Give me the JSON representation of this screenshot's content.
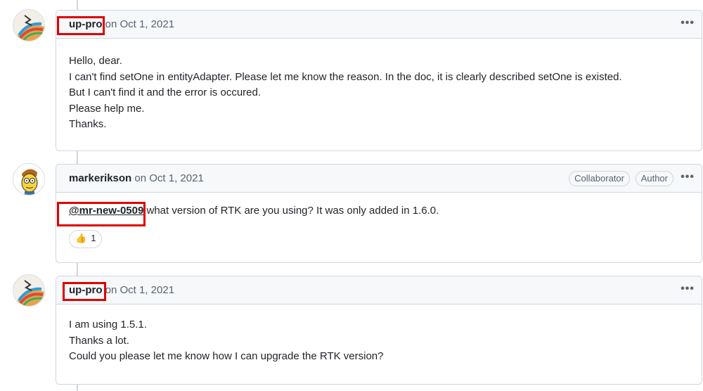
{
  "comments": [
    {
      "author": "up-pro",
      "meta": " on Oct 1, 2021",
      "menu": "•••",
      "lines": [
        "Hello, dear.",
        "I can't find setOne in entityAdapter. Please let me know the reason. In the doc, it is clearly described setOne is existed.",
        "But I can't find it and the error is occured.",
        "Please help me.",
        "Thanks."
      ]
    },
    {
      "author": "markerikson",
      "meta": " on Oct 1, 2021",
      "badges": [
        "Collaborator",
        "Author"
      ],
      "menu": "•••",
      "mention": "@mr-new-0509",
      "text": " what version of RTK are you using? It was only added in 1.6.0.",
      "reaction": {
        "emoji": "👍",
        "count": "1"
      }
    },
    {
      "author": "up-pro",
      "meta": " on Oct 1, 2021",
      "menu": "•••",
      "lines": [
        "I am using 1.5.1.",
        "Thanks a lot.",
        "Could you please let me know how I can upgrade the RTK version?"
      ]
    }
  ],
  "colors": {
    "highlight": "#e00000",
    "border": "#d0d7de",
    "header_bg": "#f6f8fa"
  }
}
